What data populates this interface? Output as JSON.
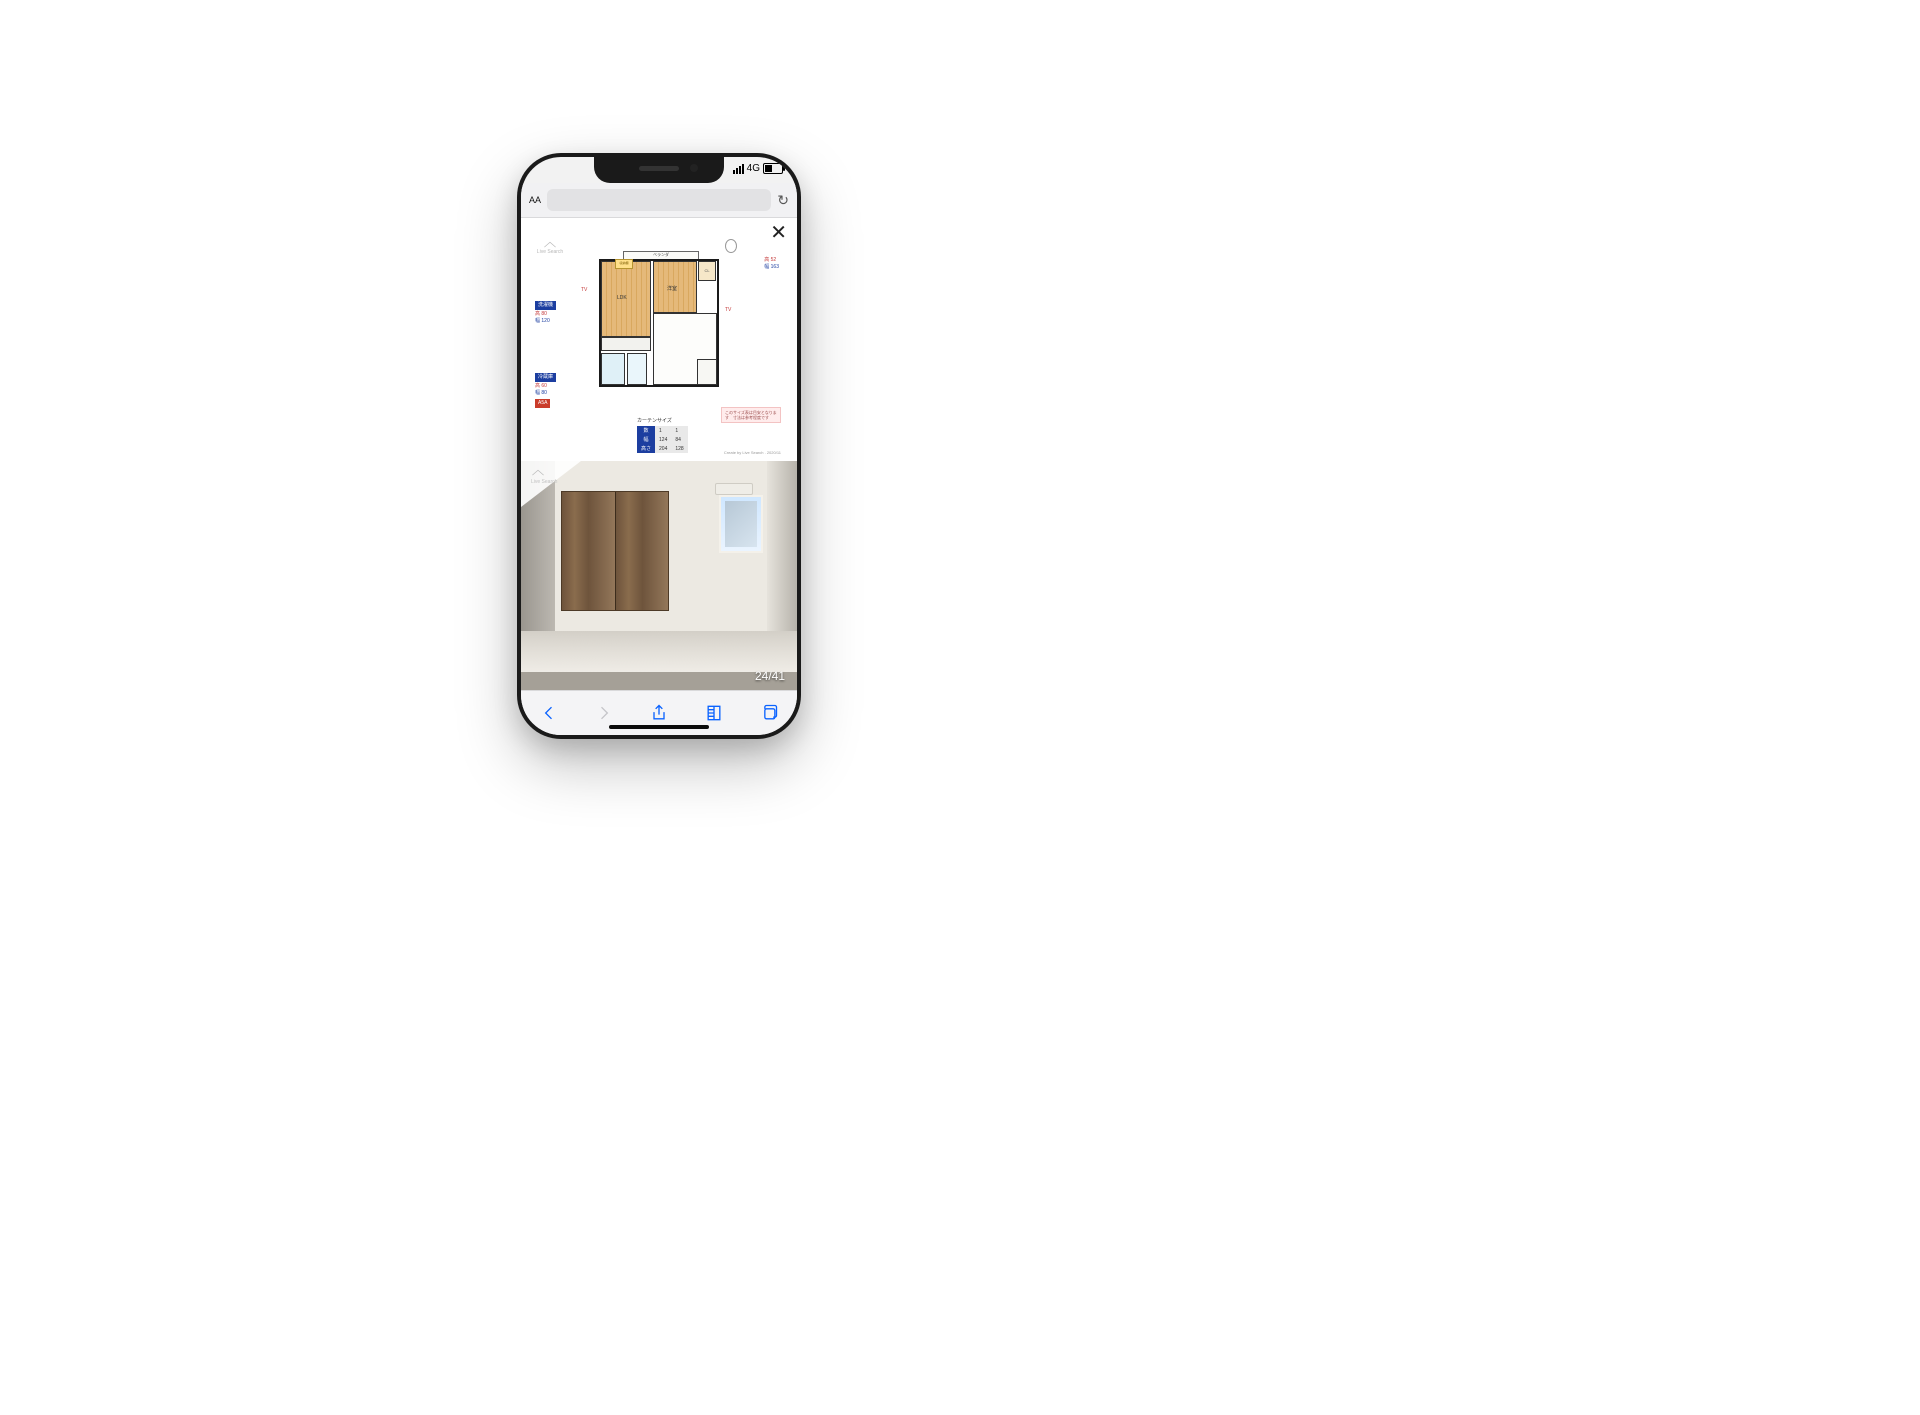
{
  "status": {
    "network": "4G"
  },
  "addressbar": {
    "aa": "AA"
  },
  "gallery": {
    "counter": "24/41"
  },
  "logo": {
    "text": "Live Search"
  },
  "floorplan": {
    "balcony": "ベランダ",
    "storage": "収納棚",
    "rooms": {
      "ldk": "LDK",
      "yoshitsu": "洋室",
      "cl": "CL"
    },
    "tv": "TV",
    "annot_right": {
      "h_label": "高",
      "h_val": "52",
      "w_label": "幅",
      "w_val": "163"
    },
    "annot_tl": {
      "tag": "洗濯機",
      "h_label": "高",
      "h_val": "80",
      "w_label": "幅",
      "w_val": "120"
    },
    "annot_bl": {
      "tag": "冷蔵庫",
      "h_label": "高",
      "h_val": "60",
      "w_label": "幅",
      "w_val": "80",
      "a_tag": "A5A"
    },
    "note": "このサイズ表は目安となります　寸法は参考程度です",
    "curtain": {
      "title": "カーテンサイズ",
      "rows": [
        {
          "label": "数",
          "a": "1",
          "b": "1"
        },
        {
          "label": "幅",
          "a": "124",
          "b": "84"
        },
        {
          "label": "高さ",
          "a": "204",
          "b": "128"
        }
      ]
    },
    "credit": "Create by Live Search . 2020/11"
  }
}
